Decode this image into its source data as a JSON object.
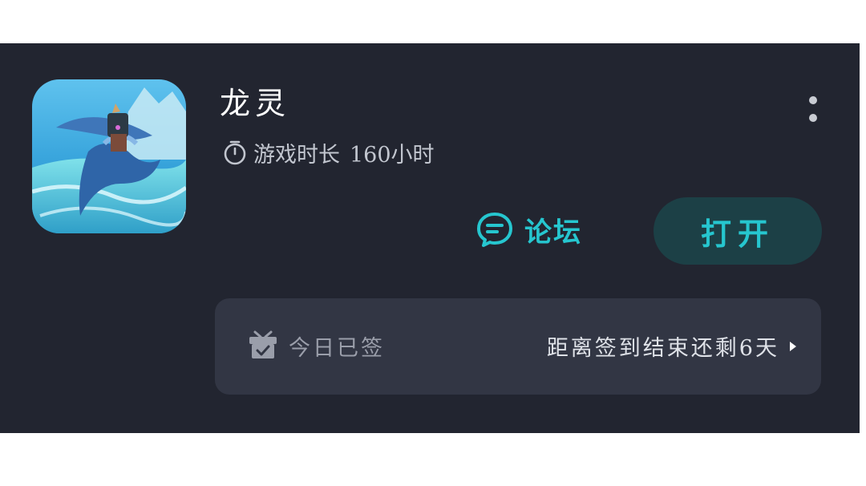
{
  "app": {
    "name": "龙灵",
    "playtime_label": "游戏时长",
    "playtime_value": "160小时"
  },
  "actions": {
    "forum_label": "论坛",
    "open_label": "打开"
  },
  "signin": {
    "status": "今日已签",
    "countdown": "距离签到结束还剩6天"
  },
  "colors": {
    "card_background": "#222530",
    "accent": "#26c6cf",
    "open_button_background": "#1c4046",
    "signin_bar_background": "#323644"
  },
  "icons": {
    "timer": "stopwatch-icon",
    "more": "more-vertical-icon",
    "forum": "chat-bubble-icon",
    "gift": "gift-box-icon",
    "arrow": "triangle-right-icon"
  }
}
